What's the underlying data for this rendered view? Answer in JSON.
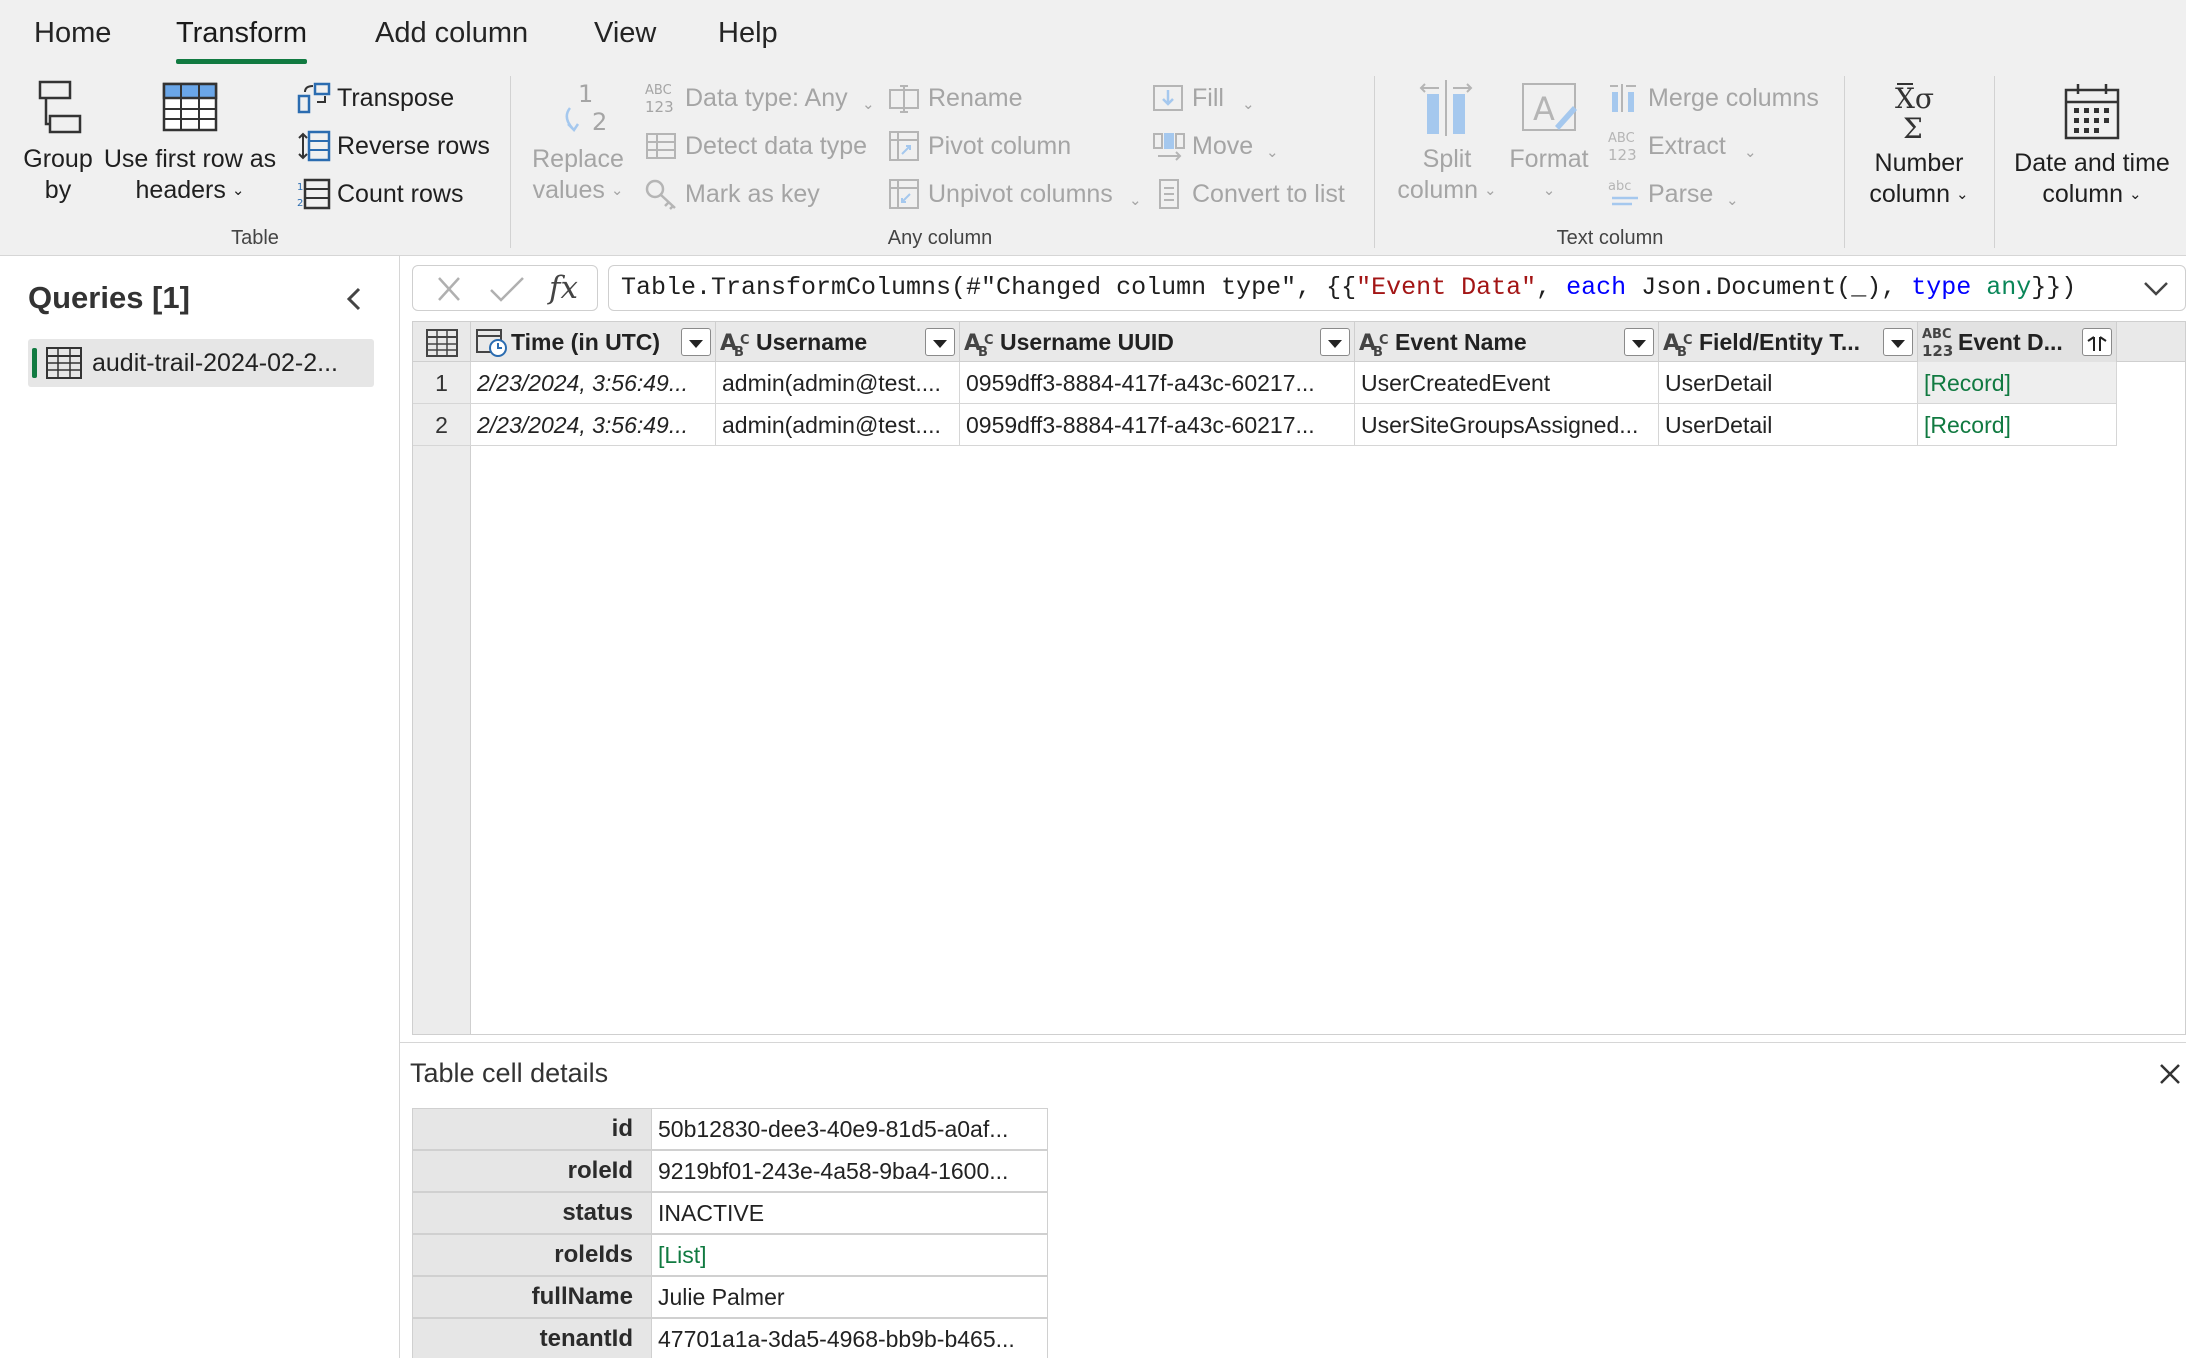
{
  "tabs": [
    "Home",
    "Transform",
    "Add column",
    "View",
    "Help"
  ],
  "ribbon": {
    "table_group": {
      "label": "Table",
      "group_by_line1": "Group",
      "group_by_line2": "by",
      "first_row_line1": "Use first row as",
      "first_row_line2": "headers",
      "transpose": "Transpose",
      "reverse_rows": "Reverse rows",
      "count_rows": "Count rows"
    },
    "any_column_group": {
      "label": "Any column",
      "replace_line1": "Replace",
      "replace_line2": "values",
      "data_type": "Data type: Any",
      "detect_data_type": "Detect data type",
      "mark_as_key": "Mark as key",
      "rename": "Rename",
      "pivot_column": "Pivot column",
      "unpivot_columns": "Unpivot columns",
      "fill": "Fill",
      "move": "Move",
      "convert_to_list": "Convert to list"
    },
    "text_column_group": {
      "label": "Text column",
      "split_line1": "Split",
      "split_line2": "column",
      "format": "Format",
      "merge_columns": "Merge columns",
      "extract": "Extract",
      "parse": "Parse"
    },
    "number_column_line1": "Number",
    "number_column_line2": "column",
    "date_time_line1": "Date and time",
    "date_time_line2": "column"
  },
  "queries": {
    "title": "Queries [1]",
    "items": [
      "audit-trail-2024-02-2..."
    ]
  },
  "formula": {
    "part1": "Table.TransformColumns(#\"Changed column type\", {{",
    "part2": "\"Event Data\"",
    "part3": ", ",
    "part4": "each",
    "part5": " Json.Document(_), ",
    "part6": "type",
    "part7": " ",
    "part8": "any",
    "part9": "}})"
  },
  "grid": {
    "columns": [
      "Time (in UTC)",
      "Username",
      "Username UUID",
      "Event Name",
      "Field/Entity T...",
      "Event D..."
    ],
    "rows": [
      [
        "1",
        "2/23/2024, 3:56:49...",
        "admin(admin@test....",
        "0959dff3-8884-417f-a43c-60217...",
        "UserCreatedEvent",
        "UserDetail",
        "[Record]"
      ],
      [
        "2",
        "2/23/2024, 3:56:49...",
        "admin(admin@test....",
        "0959dff3-8884-417f-a43c-60217...",
        "UserSiteGroupsAssigned...",
        "UserDetail",
        "[Record]"
      ]
    ]
  },
  "details": {
    "title": "Table cell details",
    "rows": [
      {
        "key": "id",
        "value": "50b12830-dee3-40e9-81d5-a0af..."
      },
      {
        "key": "roleId",
        "value": "9219bf01-243e-4a58-9ba4-1600..."
      },
      {
        "key": "status",
        "value": "INACTIVE"
      },
      {
        "key": "roleIds",
        "value": "[List]"
      },
      {
        "key": "fullName",
        "value": "Julie Palmer"
      },
      {
        "key": "tenantId",
        "value": "47701a1a-3da5-4968-bb9b-b465..."
      }
    ]
  },
  "colors": {
    "accent_green": "#117a41",
    "record_green": "#117a41",
    "icon_blue": "#2b6cb0",
    "formula_string": "#a31515",
    "formula_keyword": "#0000ff",
    "formula_type": "#098658"
  }
}
